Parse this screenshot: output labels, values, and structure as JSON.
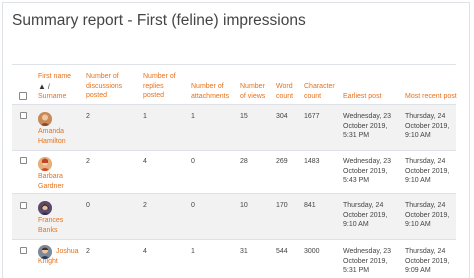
{
  "page": {
    "title": "Summary report - First (feline) impressions"
  },
  "table": {
    "headers": {
      "first_name": "First name",
      "sort_arrow": "▲",
      "slash": "/",
      "surname": "Surname",
      "discussions_1": "Number of",
      "discussions_2": "discussions",
      "discussions_3": "posted",
      "replies_1": "Number of",
      "replies_2": "replies",
      "replies_3": "posted",
      "attachments_1": "Number of",
      "attachments_2": "attachments",
      "views_1": "Number",
      "views_2": "of views",
      "word_1": "Word",
      "word_2": "count",
      "char_1": "Character",
      "char_2": "count",
      "earliest": "Earliest post",
      "recent": "Most recent post"
    },
    "rows": [
      {
        "name_1": "Amanda",
        "name_2": "Hamilton",
        "discussions": "2",
        "replies": "1",
        "attachments": "1",
        "views": "15",
        "words": "304",
        "chars": "1677",
        "earliest_1": "Wednesday, 23",
        "earliest_2": "October 2019,",
        "earliest_3": "5:31 PM",
        "recent_1": "Thursday, 24",
        "recent_2": "October 2019,",
        "recent_3": "9:10 AM"
      },
      {
        "name_1": "Barbara",
        "name_2": "Gardner",
        "discussions": "2",
        "replies": "4",
        "attachments": "0",
        "views": "28",
        "words": "269",
        "chars": "1483",
        "earliest_1": "Wednesday, 23",
        "earliest_2": "October 2019,",
        "earliest_3": "5:43 PM",
        "recent_1": "Thursday, 24",
        "recent_2": "October 2019,",
        "recent_3": "9:10 AM"
      },
      {
        "name_1": "Frances",
        "name_2": "Banks",
        "discussions": "0",
        "replies": "2",
        "attachments": "0",
        "views": "10",
        "words": "170",
        "chars": "841",
        "earliest_1": "Thursday, 24",
        "earliest_2": "October 2019,",
        "earliest_3": "9:10 AM",
        "recent_1": "Thursday, 24",
        "recent_2": "October 2019,",
        "recent_3": "9:10 AM"
      },
      {
        "name_1": "Joshua",
        "name_2": "Knight",
        "discussions": "2",
        "replies": "4",
        "attachments": "1",
        "views": "31",
        "words": "544",
        "chars": "3000",
        "earliest_1": "Wednesday, 23",
        "earliest_2": "October 2019,",
        "earliest_3": "5:31 PM",
        "recent_1": "Thursday, 24",
        "recent_2": "October 2019,",
        "recent_3": "9:09 AM"
      }
    ]
  }
}
